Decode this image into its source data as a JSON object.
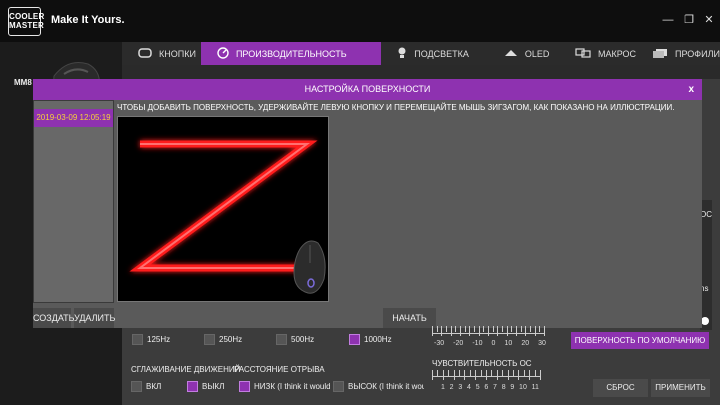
{
  "brand": {
    "logo_text": "COOLER MASTER",
    "tagline": "Make It Yours."
  },
  "device": {
    "name": "MM8"
  },
  "tabs": [
    {
      "label": "КНОПКИ",
      "icon": "mouse-buttons-icon"
    },
    {
      "label": "ПРОИЗВОДИТЕЛЬНОСТЬ",
      "icon": "performance-icon",
      "active": true
    },
    {
      "label": "ПОДСВЕТКА",
      "icon": "lighting-icon"
    },
    {
      "label": "OLED",
      "icon": "oled-icon"
    },
    {
      "label": "МАКРОС",
      "icon": "macro-icon"
    },
    {
      "label": "ПРОФИЛИ",
      "icon": "profiles-icon"
    }
  ],
  "dialog": {
    "title": "НАСТРОЙКА ПОВЕРХНОСТИ",
    "close_label": "x",
    "instruction": "ЧТОБЫ ДОБАВИТЬ ПОВЕРХНОСТЬ, УДЕРЖИВАЙТЕ ЛЕВУЮ КНОПКУ И ПЕРЕМЕЩАЙТЕ МЫШЬ ЗИГЗАГОМ, КАК ПОКАЗАНО НА ИЛЛЮСТРАЦИИ.",
    "surfaces": [
      "2019-03-09 12:05:19"
    ],
    "create_label": "СОЗДАТЬ",
    "delete_label": "УДАЛИТЬ",
    "start_label": "НАЧАТЬ"
  },
  "polling": {
    "options": [
      {
        "label": "125Hz",
        "checked": false
      },
      {
        "label": "250Hz",
        "checked": false
      },
      {
        "label": "500Hz",
        "checked": false
      },
      {
        "label": "1000Hz",
        "checked": true
      }
    ]
  },
  "smoothing": {
    "title": "СГЛАЖИВАНИЕ ДВИЖЕНИЙ",
    "options": [
      {
        "label": "ВКЛ",
        "checked": false
      },
      {
        "label": "ВЫКЛ",
        "checked": true
      }
    ]
  },
  "lift_off": {
    "title": "РАССТОЯНИЕ ОТРЫВА",
    "options": [
      {
        "label": "НИЗК (I think it would",
        "checked": true
      },
      {
        "label": "ВЫСОК (I think it wou",
        "checked": false
      }
    ]
  },
  "angle_slider": {
    "ticks": [
      "-30",
      "-20",
      "-10",
      "0",
      "10",
      "20",
      "30"
    ]
  },
  "sensitivity": {
    "title": "ЧУВСТВИТЕЛЬНОСТЬ ОС",
    "ticks": [
      "1",
      "2",
      "3",
      "4",
      "5",
      "6",
      "7",
      "8",
      "9",
      "10",
      "11"
    ]
  },
  "right_partial": {
    "top_text": "ОС",
    "mid_text": "ns"
  },
  "buttons": {
    "surface_default": "ПОВЕРХНОСТЬ ПО УМОЛЧАНИЮ",
    "reset": "СБРОС",
    "apply": "ПРИМЕНИТЬ"
  },
  "colors": {
    "accent": "#8e32b0",
    "timestamp": "#f4d13a",
    "z_glow": "#ff1a1a"
  }
}
